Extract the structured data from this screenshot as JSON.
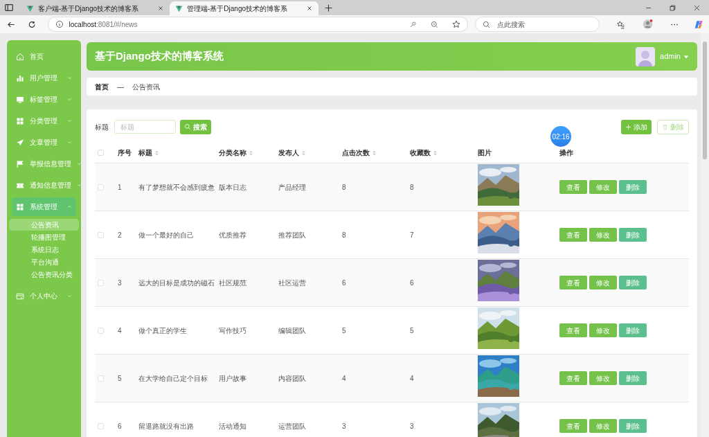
{
  "browser": {
    "tabs": [
      {
        "title": "客户端-基于Django技术的博客系",
        "selected": false
      },
      {
        "title": "管理端-基于Django技术的博客系",
        "selected": true
      }
    ],
    "address": {
      "host": "localhost",
      "path": ":8081/#/news"
    },
    "search": {
      "placeholder": "点此搜索"
    }
  },
  "sidebar": {
    "items": [
      {
        "label": "首页",
        "expanded": false
      },
      {
        "label": "用户管理",
        "expanded": false,
        "has_children": true
      },
      {
        "label": "标签管理",
        "expanded": false,
        "has_children": true
      },
      {
        "label": "分类管理",
        "expanded": false,
        "has_children": true
      },
      {
        "label": "文章管理",
        "expanded": false,
        "has_children": true
      },
      {
        "label": "举报信息管理",
        "expanded": false,
        "has_children": true
      },
      {
        "label": "通知信息管理",
        "expanded": false,
        "has_children": true
      },
      {
        "label": "系统管理",
        "expanded": true,
        "has_children": true,
        "children": [
          {
            "label": "公告资讯",
            "selected": true
          },
          {
            "label": "轮播图管理",
            "selected": false
          },
          {
            "label": "系统日志",
            "selected": false
          },
          {
            "label": "平台沟通",
            "selected": false
          },
          {
            "label": "公告资讯分类",
            "selected": false
          }
        ]
      },
      {
        "label": "个人中心",
        "expanded": false,
        "has_children": true
      }
    ]
  },
  "header": {
    "title": "基于Django技术的博客系统",
    "user": "admin"
  },
  "breadcrumb": {
    "items": [
      "首页",
      "公告资讯"
    ],
    "separator": "—"
  },
  "filter": {
    "label": "标题",
    "placeholder": "标题",
    "search_button": "搜索"
  },
  "actions": {
    "add": "添加",
    "delete": "删除"
  },
  "timer_badge": "02:16",
  "table": {
    "select_all_checked": false,
    "columns": [
      {
        "label": "序号",
        "sortable": false
      },
      {
        "label": "标题",
        "sortable": true
      },
      {
        "label": "分类名称",
        "sortable": true
      },
      {
        "label": "发布人",
        "sortable": true
      },
      {
        "label": "点击次数",
        "sortable": true
      },
      {
        "label": "收藏数",
        "sortable": true
      },
      {
        "label": "图片",
        "sortable": false
      },
      {
        "label": "操作",
        "sortable": false
      }
    ],
    "rows": [
      {
        "no": "1",
        "title": "有了梦想就不会感到疲惫",
        "category": "版本日志",
        "publisher": "产品经理",
        "clicks": "8",
        "favorites": "8",
        "checked": false,
        "buttons": [
          "查看",
          "修改",
          "删除"
        ]
      },
      {
        "no": "2",
        "title": "做一个最好的自己",
        "category": "优质推荐",
        "publisher": "推荐团队",
        "clicks": "8",
        "favorites": "7",
        "checked": false,
        "buttons": [
          "查看",
          "修改",
          "删除"
        ]
      },
      {
        "no": "3",
        "title": "远大的目标是成功的磁石",
        "category": "社区规范",
        "publisher": "社区运营",
        "clicks": "6",
        "favorites": "6",
        "checked": false,
        "buttons": [
          "查看",
          "修改",
          "删除"
        ]
      },
      {
        "no": "4",
        "title": "做个真正的学生",
        "category": "写作技巧",
        "publisher": "编辑团队",
        "clicks": "5",
        "favorites": "5",
        "checked": false,
        "buttons": [
          "查看",
          "修改",
          "删除"
        ]
      },
      {
        "no": "5",
        "title": "在大学给自己定个目标",
        "category": "用户故事",
        "publisher": "内容团队",
        "clicks": "4",
        "favorites": "4",
        "checked": false,
        "buttons": [
          "查看",
          "修改",
          "删除"
        ]
      },
      {
        "no": "6",
        "title": "留退路就没有出路",
        "category": "活动通知",
        "publisher": "运营团队",
        "clicks": "3",
        "favorites": "3",
        "checked": false,
        "buttons": [
          "查看",
          "修改",
          "删除"
        ]
      }
    ]
  }
}
